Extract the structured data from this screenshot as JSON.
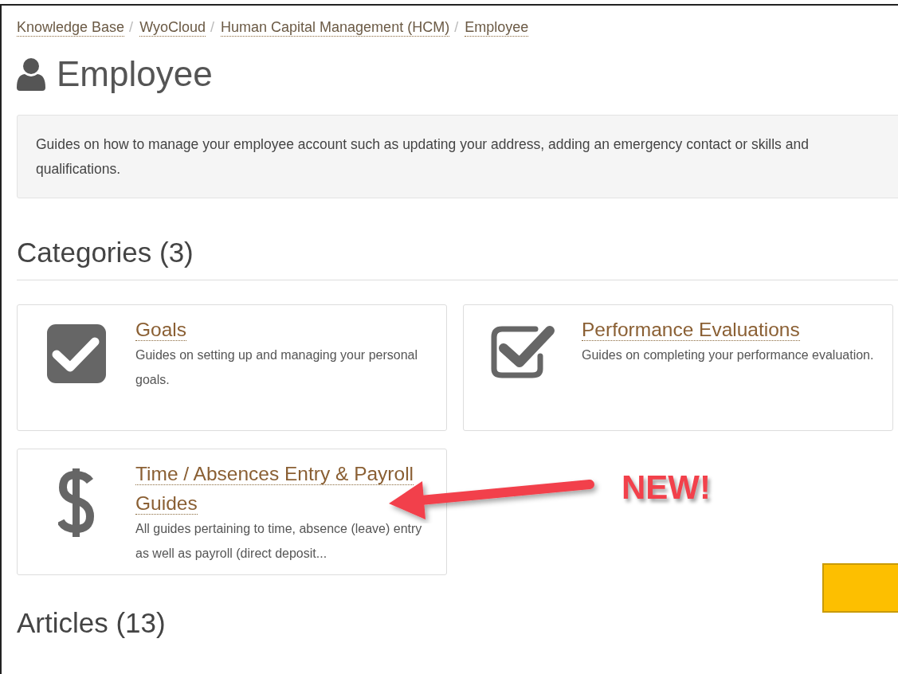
{
  "breadcrumb": [
    {
      "label": "Knowledge Base"
    },
    {
      "label": "WyoCloud"
    },
    {
      "label": "Human Capital Management (HCM)"
    },
    {
      "label": "Employee"
    }
  ],
  "breadcrumb_separator": "/",
  "title": "Employee",
  "description": "Guides on how to manage your employee account such as updating your address, adding an emergency contact or skills and qualifications.",
  "categories_heading": "Categories (3)",
  "categories": [
    {
      "kind": "checkbox-filled",
      "title": "Goals",
      "description": "Guides on setting up and managing your personal goals."
    },
    {
      "kind": "checkbox-outline",
      "title": "Performance Evaluations",
      "description": "Guides on completing your performance evaluation."
    },
    {
      "kind": "dollar",
      "title": "Time / Absences Entry & Payroll Guides",
      "description": "All guides pertaining to time, absence (leave) entry as well as payroll (direct deposit..."
    }
  ],
  "annotation": {
    "text": "NEW!"
  },
  "articles_heading": "Articles (13)"
}
